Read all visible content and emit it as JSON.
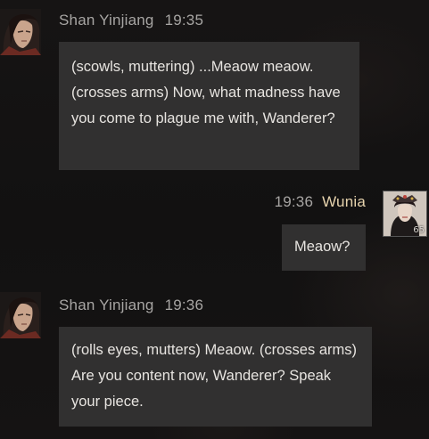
{
  "messages": [
    {
      "sender": "Shan Yinjiang",
      "time": "19:35",
      "text": "(scowls, muttering) ...Meaow meaow. (crosses arms) Now, what madness have you come to plague me with, Wanderer?",
      "side": "left",
      "avatar": "character-portrait"
    },
    {
      "sender": "Wunia",
      "time": "19:36",
      "text": "Meaow?",
      "side": "right",
      "avatar": "player-portrait",
      "level_badge": "65"
    },
    {
      "sender": "Shan Yinjiang",
      "time": "19:36",
      "text": "(rolls eyes, mutters) Meaow. (crosses arms) Are you content now, Wanderer? Speak your piece.",
      "side": "left",
      "avatar": "character-portrait"
    }
  ],
  "colors": {
    "background": "#141313",
    "bubble": "#313030",
    "text": "#e7e4e0",
    "meta": "#a7a5a3",
    "self_name": "#e6d3ad"
  }
}
